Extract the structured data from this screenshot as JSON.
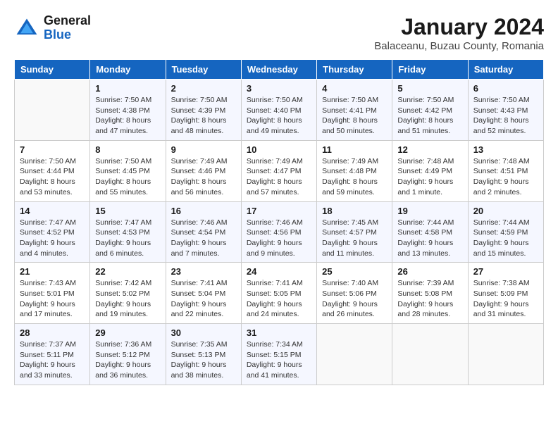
{
  "header": {
    "logo_line1": "General",
    "logo_line2": "Blue",
    "month_title": "January 2024",
    "subtitle": "Balaceanu, Buzau County, Romania"
  },
  "weekdays": [
    "Sunday",
    "Monday",
    "Tuesday",
    "Wednesday",
    "Thursday",
    "Friday",
    "Saturday"
  ],
  "weeks": [
    [
      {
        "day": "",
        "sunrise": "",
        "sunset": "",
        "daylight": ""
      },
      {
        "day": "1",
        "sunrise": "Sunrise: 7:50 AM",
        "sunset": "Sunset: 4:38 PM",
        "daylight": "Daylight: 8 hours and 47 minutes."
      },
      {
        "day": "2",
        "sunrise": "Sunrise: 7:50 AM",
        "sunset": "Sunset: 4:39 PM",
        "daylight": "Daylight: 8 hours and 48 minutes."
      },
      {
        "day": "3",
        "sunrise": "Sunrise: 7:50 AM",
        "sunset": "Sunset: 4:40 PM",
        "daylight": "Daylight: 8 hours and 49 minutes."
      },
      {
        "day": "4",
        "sunrise": "Sunrise: 7:50 AM",
        "sunset": "Sunset: 4:41 PM",
        "daylight": "Daylight: 8 hours and 50 minutes."
      },
      {
        "day": "5",
        "sunrise": "Sunrise: 7:50 AM",
        "sunset": "Sunset: 4:42 PM",
        "daylight": "Daylight: 8 hours and 51 minutes."
      },
      {
        "day": "6",
        "sunrise": "Sunrise: 7:50 AM",
        "sunset": "Sunset: 4:43 PM",
        "daylight": "Daylight: 8 hours and 52 minutes."
      }
    ],
    [
      {
        "day": "7",
        "sunrise": "Sunrise: 7:50 AM",
        "sunset": "Sunset: 4:44 PM",
        "daylight": "Daylight: 8 hours and 53 minutes."
      },
      {
        "day": "8",
        "sunrise": "Sunrise: 7:50 AM",
        "sunset": "Sunset: 4:45 PM",
        "daylight": "Daylight: 8 hours and 55 minutes."
      },
      {
        "day": "9",
        "sunrise": "Sunrise: 7:49 AM",
        "sunset": "Sunset: 4:46 PM",
        "daylight": "Daylight: 8 hours and 56 minutes."
      },
      {
        "day": "10",
        "sunrise": "Sunrise: 7:49 AM",
        "sunset": "Sunset: 4:47 PM",
        "daylight": "Daylight: 8 hours and 57 minutes."
      },
      {
        "day": "11",
        "sunrise": "Sunrise: 7:49 AM",
        "sunset": "Sunset: 4:48 PM",
        "daylight": "Daylight: 8 hours and 59 minutes."
      },
      {
        "day": "12",
        "sunrise": "Sunrise: 7:48 AM",
        "sunset": "Sunset: 4:49 PM",
        "daylight": "Daylight: 9 hours and 1 minute."
      },
      {
        "day": "13",
        "sunrise": "Sunrise: 7:48 AM",
        "sunset": "Sunset: 4:51 PM",
        "daylight": "Daylight: 9 hours and 2 minutes."
      }
    ],
    [
      {
        "day": "14",
        "sunrise": "Sunrise: 7:47 AM",
        "sunset": "Sunset: 4:52 PM",
        "daylight": "Daylight: 9 hours and 4 minutes."
      },
      {
        "day": "15",
        "sunrise": "Sunrise: 7:47 AM",
        "sunset": "Sunset: 4:53 PM",
        "daylight": "Daylight: 9 hours and 6 minutes."
      },
      {
        "day": "16",
        "sunrise": "Sunrise: 7:46 AM",
        "sunset": "Sunset: 4:54 PM",
        "daylight": "Daylight: 9 hours and 7 minutes."
      },
      {
        "day": "17",
        "sunrise": "Sunrise: 7:46 AM",
        "sunset": "Sunset: 4:56 PM",
        "daylight": "Daylight: 9 hours and 9 minutes."
      },
      {
        "day": "18",
        "sunrise": "Sunrise: 7:45 AM",
        "sunset": "Sunset: 4:57 PM",
        "daylight": "Daylight: 9 hours and 11 minutes."
      },
      {
        "day": "19",
        "sunrise": "Sunrise: 7:44 AM",
        "sunset": "Sunset: 4:58 PM",
        "daylight": "Daylight: 9 hours and 13 minutes."
      },
      {
        "day": "20",
        "sunrise": "Sunrise: 7:44 AM",
        "sunset": "Sunset: 4:59 PM",
        "daylight": "Daylight: 9 hours and 15 minutes."
      }
    ],
    [
      {
        "day": "21",
        "sunrise": "Sunrise: 7:43 AM",
        "sunset": "Sunset: 5:01 PM",
        "daylight": "Daylight: 9 hours and 17 minutes."
      },
      {
        "day": "22",
        "sunrise": "Sunrise: 7:42 AM",
        "sunset": "Sunset: 5:02 PM",
        "daylight": "Daylight: 9 hours and 19 minutes."
      },
      {
        "day": "23",
        "sunrise": "Sunrise: 7:41 AM",
        "sunset": "Sunset: 5:04 PM",
        "daylight": "Daylight: 9 hours and 22 minutes."
      },
      {
        "day": "24",
        "sunrise": "Sunrise: 7:41 AM",
        "sunset": "Sunset: 5:05 PM",
        "daylight": "Daylight: 9 hours and 24 minutes."
      },
      {
        "day": "25",
        "sunrise": "Sunrise: 7:40 AM",
        "sunset": "Sunset: 5:06 PM",
        "daylight": "Daylight: 9 hours and 26 minutes."
      },
      {
        "day": "26",
        "sunrise": "Sunrise: 7:39 AM",
        "sunset": "Sunset: 5:08 PM",
        "daylight": "Daylight: 9 hours and 28 minutes."
      },
      {
        "day": "27",
        "sunrise": "Sunrise: 7:38 AM",
        "sunset": "Sunset: 5:09 PM",
        "daylight": "Daylight: 9 hours and 31 minutes."
      }
    ],
    [
      {
        "day": "28",
        "sunrise": "Sunrise: 7:37 AM",
        "sunset": "Sunset: 5:11 PM",
        "daylight": "Daylight: 9 hours and 33 minutes."
      },
      {
        "day": "29",
        "sunrise": "Sunrise: 7:36 AM",
        "sunset": "Sunset: 5:12 PM",
        "daylight": "Daylight: 9 hours and 36 minutes."
      },
      {
        "day": "30",
        "sunrise": "Sunrise: 7:35 AM",
        "sunset": "Sunset: 5:13 PM",
        "daylight": "Daylight: 9 hours and 38 minutes."
      },
      {
        "day": "31",
        "sunrise": "Sunrise: 7:34 AM",
        "sunset": "Sunset: 5:15 PM",
        "daylight": "Daylight: 9 hours and 41 minutes."
      },
      {
        "day": "",
        "sunrise": "",
        "sunset": "",
        "daylight": ""
      },
      {
        "day": "",
        "sunrise": "",
        "sunset": "",
        "daylight": ""
      },
      {
        "day": "",
        "sunrise": "",
        "sunset": "",
        "daylight": ""
      }
    ]
  ]
}
